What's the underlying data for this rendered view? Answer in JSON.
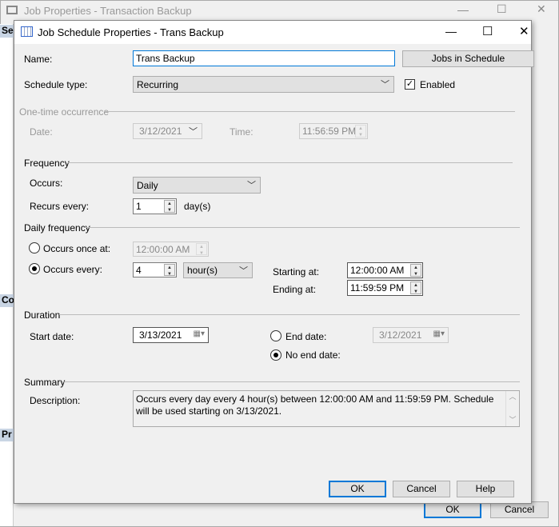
{
  "background_window": {
    "title": "Job Properties - Transaction Backup",
    "side_headers": [
      "Se",
      "Co",
      "Pr"
    ],
    "ok": "OK",
    "cancel": "Cancel"
  },
  "dialog": {
    "title": "Job Schedule Properties - Trans Backup",
    "name_label": "Name:",
    "name_value": "Trans Backup",
    "jobs_in_schedule": "Jobs in Schedule",
    "schedule_type_label": "Schedule type:",
    "schedule_type_value": "Recurring",
    "enabled_label": "Enabled",
    "enabled_checked": true,
    "one_time": {
      "title": "One-time occurrence",
      "date_label": "Date:",
      "date_value": "3/12/2021",
      "time_label": "Time:",
      "time_value": "11:56:59 PM"
    },
    "frequency": {
      "title": "Frequency",
      "occurs_label": "Occurs:",
      "occurs_value": "Daily",
      "recurs_label": "Recurs every:",
      "recurs_value": "1",
      "recurs_unit": "day(s)"
    },
    "daily_frequency": {
      "title": "Daily frequency",
      "once_label": "Occurs once at:",
      "once_value": "12:00:00 AM",
      "every_label": "Occurs every:",
      "every_value": "4",
      "every_unit": "hour(s)",
      "starting_label": "Starting at:",
      "starting_value": "12:00:00 AM",
      "ending_label": "Ending at:",
      "ending_value": "11:59:59 PM",
      "selected": "every"
    },
    "duration": {
      "title": "Duration",
      "start_label": "Start date:",
      "start_value": "3/13/2021",
      "end_label": "End date:",
      "end_value": "3/12/2021",
      "no_end_label": "No end date:",
      "selected": "no_end"
    },
    "summary": {
      "title": "Summary",
      "description_label": "Description:",
      "description": "Occurs every day every 4 hour(s) between 12:00:00 AM and 11:59:59 PM. Schedule will be used starting on 3/13/2021."
    },
    "buttons": {
      "ok": "OK",
      "cancel": "Cancel",
      "help": "Help"
    }
  }
}
